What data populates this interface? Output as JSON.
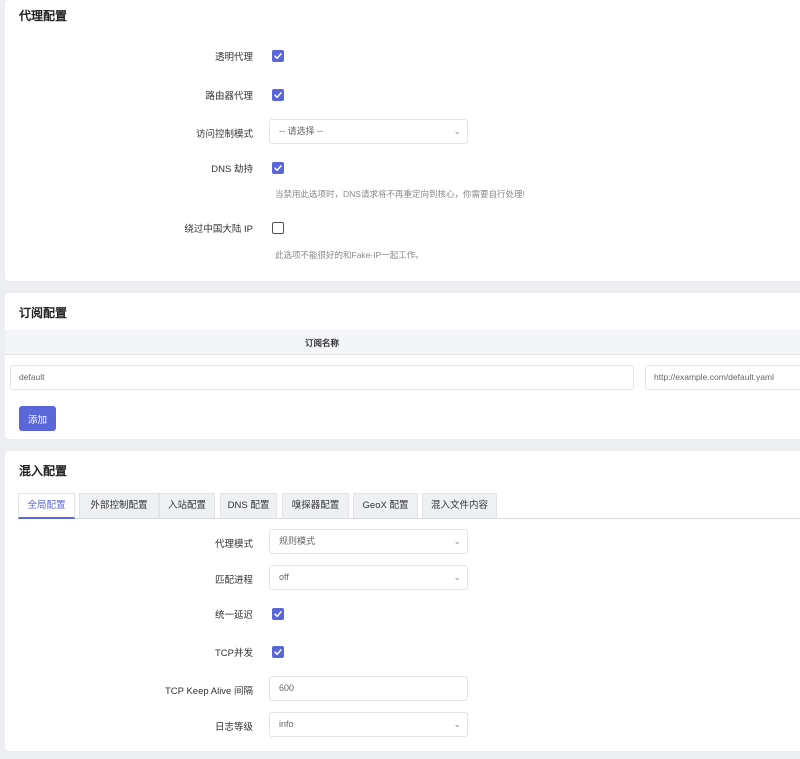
{
  "proxy": {
    "title": "代理配置",
    "transparent_label": "透明代理",
    "router_label": "路由器代理",
    "access_label": "访问控制模式",
    "access_value": "-- 请选择 --",
    "dns_label": "DNS 劫持",
    "dns_hint": "当禁用此选项时，DNS请求将不再重定向到核心，你需要自行处理!",
    "bypass_label": "绕过中国大陆 IP",
    "bypass_hint": "此选项不能很好的和Fake-IP一起工作。"
  },
  "subscription": {
    "title": "订阅配置",
    "column_name": "订阅名称",
    "row_name_value": "default",
    "row_url_value": "http://example.com/default.yaml",
    "add_label": "添加"
  },
  "mixin": {
    "title": "混入配置",
    "tabs": [
      {
        "label": "全局配置",
        "active": true
      },
      {
        "label": "外部控制配置",
        "active": false
      },
      {
        "label": "入站配置",
        "active": false
      },
      {
        "label": "DNS 配置",
        "active": false
      },
      {
        "label": "嗅探器配置",
        "active": false
      },
      {
        "label": "GeoX 配置",
        "active": false
      },
      {
        "label": "混入文件内容",
        "active": false
      }
    ],
    "mode_label": "代理模式",
    "mode_value": "规则模式",
    "process_label": "匹配进程",
    "process_value": "off",
    "unify_delay_label": "统一延迟",
    "tcp_concurrent_label": "TCP并发",
    "keepalive_label": "TCP Keep Alive 间隔",
    "keepalive_value": "600",
    "log_label": "日志等级",
    "log_value": "info"
  },
  "states": {
    "transparent": true,
    "router": true,
    "dns_hijack": true,
    "bypass_china": false,
    "unify_delay": true,
    "tcp_concurrent": true
  },
  "colors": {
    "accent": "#5a67d8",
    "page_bg": "#eceef2",
    "card_bg": "#ffffff"
  },
  "icons": {
    "check": "check-icon",
    "chevron": "chevron-down-icon"
  }
}
